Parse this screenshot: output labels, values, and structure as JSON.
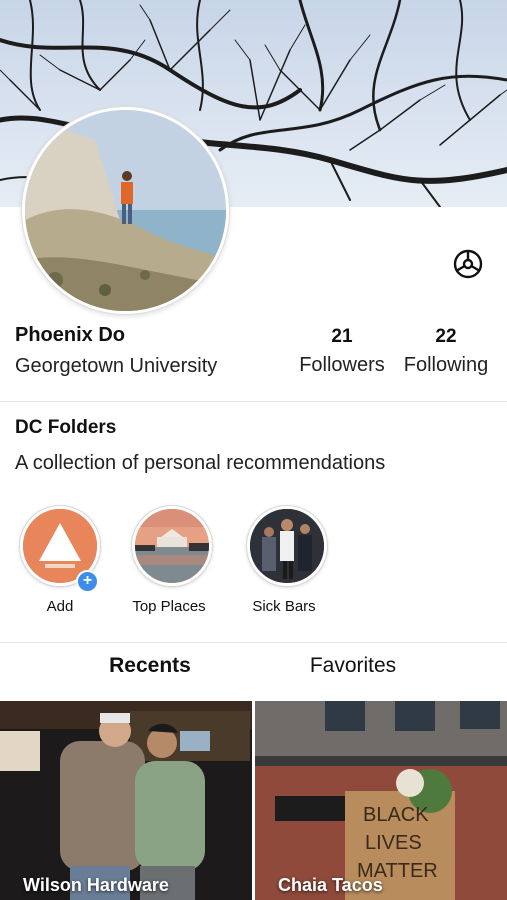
{
  "profile": {
    "name": "Phoenix Do",
    "school": "Georgetown University",
    "followers_count": "21",
    "followers_label": "Followers",
    "following_count": "22",
    "following_label": "Following"
  },
  "folders_section": {
    "title": "DC Folders",
    "description": "A collection of personal recommendations",
    "items": [
      {
        "label": "Add",
        "icon": "add-folder-icon",
        "color": "#e8855a"
      },
      {
        "label": "Top Places"
      },
      {
        "label": "Sick Bars"
      }
    ]
  },
  "tabs": [
    {
      "label": "Recents",
      "active": true
    },
    {
      "label": "Favorites",
      "active": false
    }
  ],
  "recents": [
    {
      "label": "Wilson Hardware"
    },
    {
      "label": "Chaia Tacos"
    }
  ],
  "icons": {
    "settings": "settings-wheel-icon",
    "add_badge": "plus-badge-icon"
  },
  "colors": {
    "accent_orange": "#e8855a",
    "badge_blue": "#3d8ee8"
  }
}
